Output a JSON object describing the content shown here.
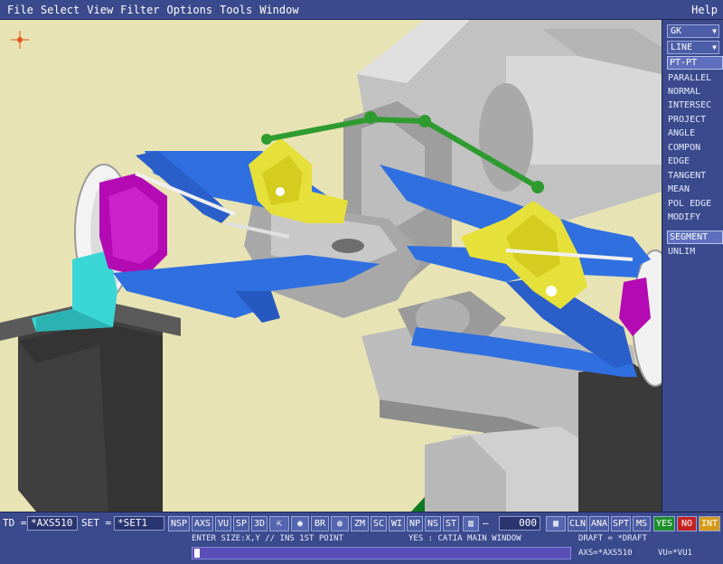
{
  "menu": {
    "items": [
      "File",
      "Select",
      "View",
      "Filter",
      "Options",
      "Tools",
      "Window"
    ],
    "help": "Help"
  },
  "side_panel": {
    "dropdown1": "GK",
    "dropdown2": "LINE",
    "selected_top": "PT-PT",
    "items": [
      "PARALLEL",
      "NORMAL",
      "INTERSEC",
      "PROJECT",
      "ANGLE",
      "COMPON",
      "EDGE",
      "TANGENT",
      "MEAN",
      "POL EDGE",
      "MODIFY"
    ],
    "selected_mid": "SEGMENT",
    "last": "UNLIM"
  },
  "toolbar": {
    "td_label": "TD =",
    "td_value": "*AXS510",
    "set_label": "SET =",
    "set_value": "*SET1",
    "buttons": [
      "NSP",
      "AXS",
      "VU",
      "SP",
      "3D"
    ],
    "buttons2": [
      "BR",
      "ZM",
      "SC",
      "WI",
      "NP",
      "NS",
      "ST"
    ],
    "layer_value": "000",
    "buttons3": [
      "CLN",
      "ANA",
      "SPT",
      "MS"
    ],
    "yes": "YES",
    "no": "NO",
    "int": "INT",
    "colors": {
      "yes": "#1d8f2a",
      "no": "#c42323",
      "int": "#d59a18"
    }
  },
  "status": {
    "prompt": "ENTER SIZE:X,Y // INS 1ST POINT",
    "window": "YES : CATIA MAIN WINDOW",
    "draft": "DRAFT = *DRAFT",
    "axs": "AXS=*AXS510",
    "vu": "VU=*VU1"
  }
}
